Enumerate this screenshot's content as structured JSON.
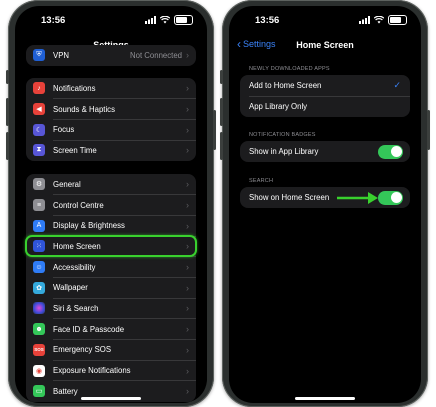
{
  "colors": {
    "accent": "#3a82f7",
    "highlight": "#39d12e",
    "toggle_on": "#34c759"
  },
  "left_phone": {
    "time": "13:56",
    "title": "Settings",
    "vpn": {
      "label": "VPN",
      "value": "Not Connected",
      "icon": "vpn-icon",
      "color": "#1f5fd4"
    },
    "group2": [
      {
        "label": "Notifications",
        "icon": "bell-icon",
        "color": "#e8423a"
      },
      {
        "label": "Sounds & Haptics",
        "icon": "speaker-icon",
        "color": "#e8423a"
      },
      {
        "label": "Focus",
        "icon": "moon-icon",
        "color": "#5856d6"
      },
      {
        "label": "Screen Time",
        "icon": "hourglass-icon",
        "color": "#5856d6"
      }
    ],
    "group3": [
      {
        "label": "General",
        "icon": "gear-icon",
        "color": "#8e8e93"
      },
      {
        "label": "Control Centre",
        "icon": "sliders-icon",
        "color": "#8e8e93"
      },
      {
        "label": "Display & Brightness",
        "icon": "text-size-icon",
        "color": "#2f7cf6"
      },
      {
        "label": "Home Screen",
        "icon": "home-grid-icon",
        "color": "#2f54d8"
      },
      {
        "label": "Accessibility",
        "icon": "accessibility-icon",
        "color": "#2f7cf6"
      },
      {
        "label": "Wallpaper",
        "icon": "flower-icon",
        "color": "#35aadc"
      },
      {
        "label": "Siri & Search",
        "icon": "siri-icon",
        "color": "#303036"
      },
      {
        "label": "Face ID & Passcode",
        "icon": "face-id-icon",
        "color": "#34c759"
      },
      {
        "label": "Emergency SOS",
        "icon": "sos-icon",
        "color": "#e8423a"
      },
      {
        "label": "Exposure Notifications",
        "icon": "exposure-icon",
        "color": "#e8423a"
      },
      {
        "label": "Battery",
        "icon": "battery-icon",
        "color": "#34c759"
      }
    ]
  },
  "right_phone": {
    "time": "13:56",
    "back_label": "Settings",
    "title": "Home Screen",
    "section1": "NEWLY DOWNLOADED APPS",
    "opt_add": "Add to Home Screen",
    "opt_library": "App Library Only",
    "section2": "NOTIFICATION BADGES",
    "show_in_library": "Show in App Library",
    "section3": "SEARCH",
    "show_on_home": "Show on Home Screen"
  }
}
